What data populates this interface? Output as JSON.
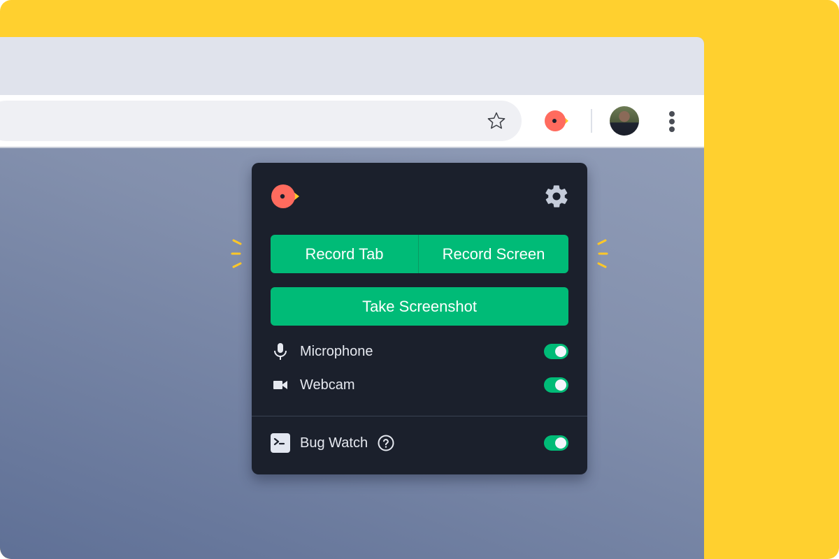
{
  "colors": {
    "canvas_yellow": "#FFD02F",
    "popup_bg": "#1B202C",
    "accent_green": "#00BB77",
    "logo_red": "#FF6B5E",
    "logo_beak": "#FFC828"
  },
  "browser": {
    "toolbar": {
      "bookmark_icon": "star-icon",
      "extension_icon": "recorder-extension-icon",
      "profile_icon": "avatar",
      "menu_icon": "kebab-menu-icon"
    }
  },
  "popup": {
    "logo_icon": "bird-logo-icon",
    "settings_icon": "gear-icon",
    "buttons": {
      "record_tab": "Record Tab",
      "record_screen": "Record Screen",
      "take_screenshot": "Take Screenshot"
    },
    "options": [
      {
        "label": "Microphone",
        "icon": "microphone-icon",
        "enabled": true
      },
      {
        "label": "Webcam",
        "icon": "video-camera-icon",
        "enabled": true
      }
    ],
    "bug_watch": {
      "label": "Bug Watch",
      "icon": "terminal-icon",
      "help_icon": "question-circle-icon",
      "enabled": true
    }
  }
}
